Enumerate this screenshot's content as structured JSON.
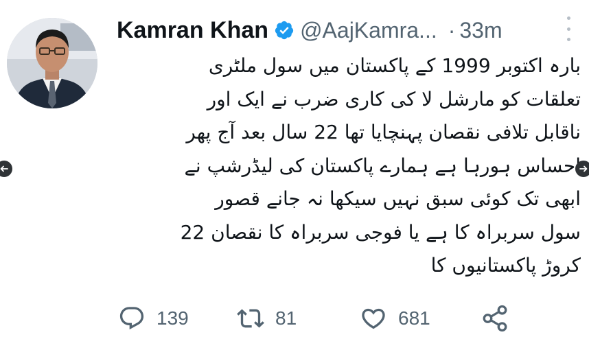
{
  "author": {
    "name": "Kamran Khan",
    "handle": "@AajKamra...",
    "verified_icon": "verified-badge-icon",
    "separator": "·",
    "time": "33m",
    "avatar_icon": "profile-photo"
  },
  "tweet": {
    "lines": [
      "بارہ اکتوبر 1999 کے پاکستان میں سول ملٹری",
      "تعلقات کو مارشل لا کی کاری ضرب نے ایک اور",
      "ناقابل تلافی نقصان پہنچایا تھا 22 سال بعد آج پھر",
      "احساس ہورہا ہے ہمارے پاکستان کی لیڈرشپ نے",
      "ابھی تک کوئی سبق نہیں سیکھا نہ جانے قصور",
      "سول سربراہ کا ہے یا فوجی سربراہ کا نقصان 22",
      "کروڑ پاکستانیوں کا"
    ]
  },
  "actions": {
    "reply": {
      "icon": "reply-icon",
      "count": "139"
    },
    "retweet": {
      "icon": "retweet-icon",
      "count": "81"
    },
    "like": {
      "icon": "heart-icon",
      "count": "681"
    },
    "share": {
      "icon": "share-icon"
    }
  },
  "colors": {
    "text": "#0f1419",
    "secondary": "#536471",
    "verified": "#1d9bf0",
    "background": "#ffffff"
  }
}
